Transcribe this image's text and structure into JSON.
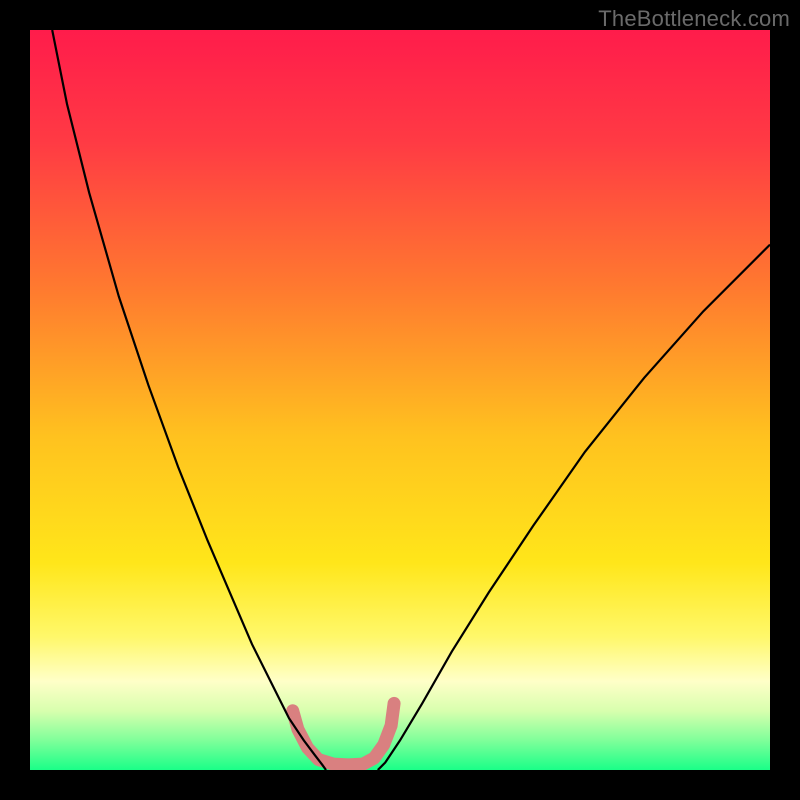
{
  "watermark": "TheBottleneck.com",
  "chart_data": {
    "type": "line",
    "title": "",
    "xlabel": "",
    "ylabel": "",
    "xlim": [
      0,
      100
    ],
    "ylim": [
      0,
      100
    ],
    "grid": false,
    "legend": false,
    "gradient_stops": [
      {
        "offset": 0.0,
        "color": "#ff1c4b"
      },
      {
        "offset": 0.15,
        "color": "#ff3a44"
      },
      {
        "offset": 0.35,
        "color": "#ff7a2f"
      },
      {
        "offset": 0.55,
        "color": "#ffc21f"
      },
      {
        "offset": 0.72,
        "color": "#ffe61a"
      },
      {
        "offset": 0.82,
        "color": "#fff86a"
      },
      {
        "offset": 0.88,
        "color": "#ffffc8"
      },
      {
        "offset": 0.92,
        "color": "#d8ffae"
      },
      {
        "offset": 0.96,
        "color": "#7fff9a"
      },
      {
        "offset": 1.0,
        "color": "#1aff88"
      }
    ],
    "series": [
      {
        "name": "left-curve",
        "stroke": "#000000",
        "stroke_width": 2.2,
        "x": [
          3,
          5,
          8,
          12,
          16,
          20,
          24,
          27,
          30,
          33,
          35,
          37,
          38.5,
          39.5,
          40
        ],
        "y": [
          100,
          90,
          78,
          64,
          52,
          41,
          31,
          24,
          17,
          11,
          7,
          4,
          2,
          0.7,
          0
        ]
      },
      {
        "name": "right-curve",
        "stroke": "#000000",
        "stroke_width": 2.2,
        "x": [
          47,
          48,
          50,
          53,
          57,
          62,
          68,
          75,
          83,
          91,
          100
        ],
        "y": [
          0,
          1,
          4,
          9,
          16,
          24,
          33,
          43,
          53,
          62,
          71
        ]
      },
      {
        "name": "bottom-band",
        "stroke": "#d98080",
        "stroke_width": 13,
        "linecap": "round",
        "x": [
          35.5,
          36.2,
          37.5,
          39,
          41,
          43,
          45,
          46.5,
          47.8,
          48.8,
          49.2
        ],
        "y": [
          8,
          5.5,
          3,
          1.4,
          0.8,
          0.7,
          0.8,
          1.6,
          3.4,
          6,
          9
        ]
      }
    ]
  }
}
